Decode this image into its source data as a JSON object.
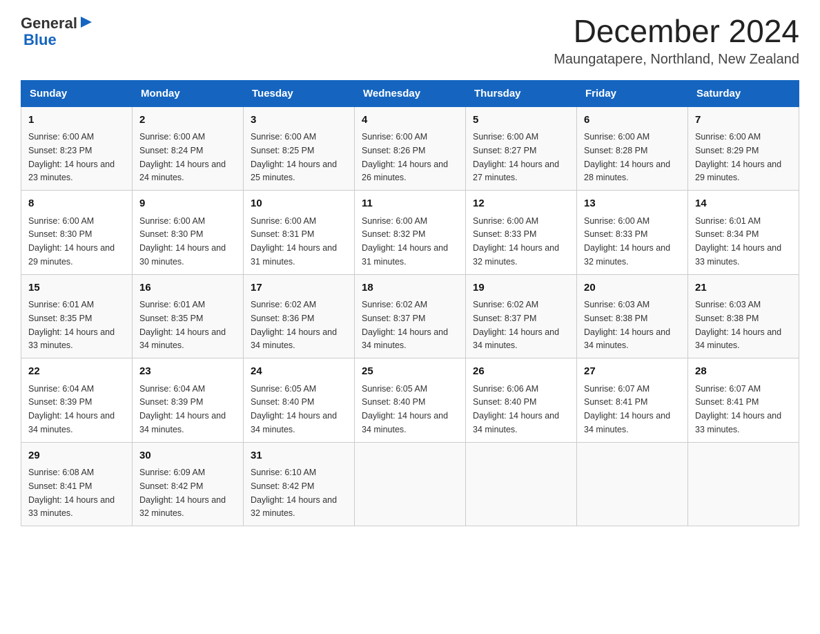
{
  "header": {
    "logo_general": "General",
    "logo_blue": "Blue",
    "month_title": "December 2024",
    "location": "Maungatapere, Northland, New Zealand"
  },
  "days_of_week": [
    "Sunday",
    "Monday",
    "Tuesday",
    "Wednesday",
    "Thursday",
    "Friday",
    "Saturday"
  ],
  "weeks": [
    [
      {
        "day": "1",
        "sunrise": "6:00 AM",
        "sunset": "8:23 PM",
        "daylight": "14 hours and 23 minutes."
      },
      {
        "day": "2",
        "sunrise": "6:00 AM",
        "sunset": "8:24 PM",
        "daylight": "14 hours and 24 minutes."
      },
      {
        "day": "3",
        "sunrise": "6:00 AM",
        "sunset": "8:25 PM",
        "daylight": "14 hours and 25 minutes."
      },
      {
        "day": "4",
        "sunrise": "6:00 AM",
        "sunset": "8:26 PM",
        "daylight": "14 hours and 26 minutes."
      },
      {
        "day": "5",
        "sunrise": "6:00 AM",
        "sunset": "8:27 PM",
        "daylight": "14 hours and 27 minutes."
      },
      {
        "day": "6",
        "sunrise": "6:00 AM",
        "sunset": "8:28 PM",
        "daylight": "14 hours and 28 minutes."
      },
      {
        "day": "7",
        "sunrise": "6:00 AM",
        "sunset": "8:29 PM",
        "daylight": "14 hours and 29 minutes."
      }
    ],
    [
      {
        "day": "8",
        "sunrise": "6:00 AM",
        "sunset": "8:30 PM",
        "daylight": "14 hours and 29 minutes."
      },
      {
        "day": "9",
        "sunrise": "6:00 AM",
        "sunset": "8:30 PM",
        "daylight": "14 hours and 30 minutes."
      },
      {
        "day": "10",
        "sunrise": "6:00 AM",
        "sunset": "8:31 PM",
        "daylight": "14 hours and 31 minutes."
      },
      {
        "day": "11",
        "sunrise": "6:00 AM",
        "sunset": "8:32 PM",
        "daylight": "14 hours and 31 minutes."
      },
      {
        "day": "12",
        "sunrise": "6:00 AM",
        "sunset": "8:33 PM",
        "daylight": "14 hours and 32 minutes."
      },
      {
        "day": "13",
        "sunrise": "6:00 AM",
        "sunset": "8:33 PM",
        "daylight": "14 hours and 32 minutes."
      },
      {
        "day": "14",
        "sunrise": "6:01 AM",
        "sunset": "8:34 PM",
        "daylight": "14 hours and 33 minutes."
      }
    ],
    [
      {
        "day": "15",
        "sunrise": "6:01 AM",
        "sunset": "8:35 PM",
        "daylight": "14 hours and 33 minutes."
      },
      {
        "day": "16",
        "sunrise": "6:01 AM",
        "sunset": "8:35 PM",
        "daylight": "14 hours and 34 minutes."
      },
      {
        "day": "17",
        "sunrise": "6:02 AM",
        "sunset": "8:36 PM",
        "daylight": "14 hours and 34 minutes."
      },
      {
        "day": "18",
        "sunrise": "6:02 AM",
        "sunset": "8:37 PM",
        "daylight": "14 hours and 34 minutes."
      },
      {
        "day": "19",
        "sunrise": "6:02 AM",
        "sunset": "8:37 PM",
        "daylight": "14 hours and 34 minutes."
      },
      {
        "day": "20",
        "sunrise": "6:03 AM",
        "sunset": "8:38 PM",
        "daylight": "14 hours and 34 minutes."
      },
      {
        "day": "21",
        "sunrise": "6:03 AM",
        "sunset": "8:38 PM",
        "daylight": "14 hours and 34 minutes."
      }
    ],
    [
      {
        "day": "22",
        "sunrise": "6:04 AM",
        "sunset": "8:39 PM",
        "daylight": "14 hours and 34 minutes."
      },
      {
        "day": "23",
        "sunrise": "6:04 AM",
        "sunset": "8:39 PM",
        "daylight": "14 hours and 34 minutes."
      },
      {
        "day": "24",
        "sunrise": "6:05 AM",
        "sunset": "8:40 PM",
        "daylight": "14 hours and 34 minutes."
      },
      {
        "day": "25",
        "sunrise": "6:05 AM",
        "sunset": "8:40 PM",
        "daylight": "14 hours and 34 minutes."
      },
      {
        "day": "26",
        "sunrise": "6:06 AM",
        "sunset": "8:40 PM",
        "daylight": "14 hours and 34 minutes."
      },
      {
        "day": "27",
        "sunrise": "6:07 AM",
        "sunset": "8:41 PM",
        "daylight": "14 hours and 34 minutes."
      },
      {
        "day": "28",
        "sunrise": "6:07 AM",
        "sunset": "8:41 PM",
        "daylight": "14 hours and 33 minutes."
      }
    ],
    [
      {
        "day": "29",
        "sunrise": "6:08 AM",
        "sunset": "8:41 PM",
        "daylight": "14 hours and 33 minutes."
      },
      {
        "day": "30",
        "sunrise": "6:09 AM",
        "sunset": "8:42 PM",
        "daylight": "14 hours and 32 minutes."
      },
      {
        "day": "31",
        "sunrise": "6:10 AM",
        "sunset": "8:42 PM",
        "daylight": "14 hours and 32 minutes."
      },
      null,
      null,
      null,
      null
    ]
  ]
}
